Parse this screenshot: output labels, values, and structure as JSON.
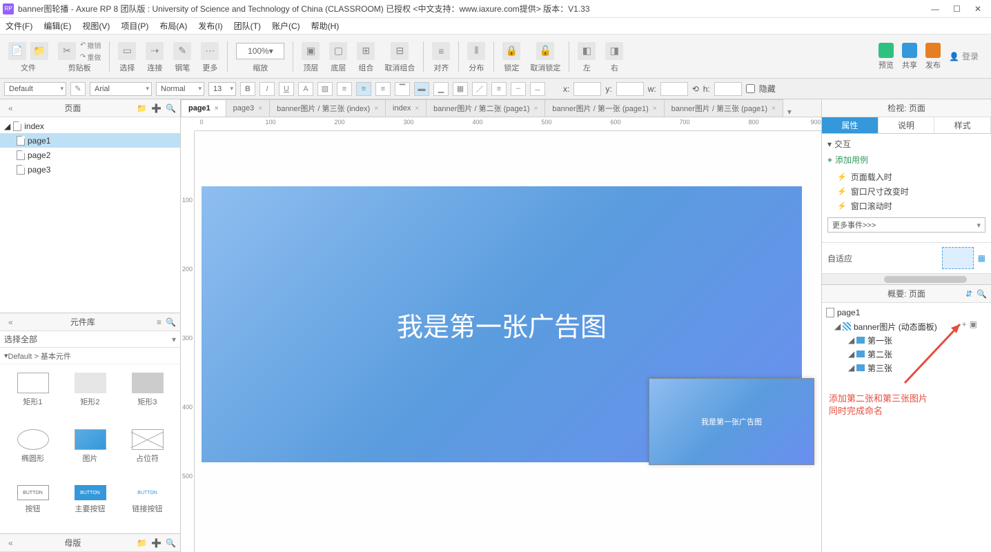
{
  "title": "banner图轮播 - Axure RP 8 团队版 : University of Science and Technology of China (CLASSROOM) 已授权    <中文支持：www.iaxure.com提供> 版本：V1.33",
  "menu": [
    "文件(F)",
    "编辑(E)",
    "视图(V)",
    "项目(P)",
    "布局(A)",
    "发布(I)",
    "团队(T)",
    "账户(C)",
    "帮助(H)"
  ],
  "toolbar": {
    "file": "文件",
    "clipboard": "剪贴板",
    "undo": "撤销",
    "redo": "重做",
    "select": "选择",
    "connect": "连接",
    "pen": "钢笔",
    "more": "更多",
    "zoom": "100%",
    "zoomLabel": "缩放",
    "top": "顶层",
    "bottom": "底层",
    "group": "组合",
    "ungroup": "取消组合",
    "align": "对齐",
    "distribute": "分布",
    "lock": "锁定",
    "unlock": "取消锁定",
    "left": "左",
    "right": "右",
    "preview": "预览",
    "share": "共享",
    "publish": "发布",
    "login": "登录"
  },
  "format": {
    "style": "Default",
    "font": "Arial",
    "weight": "Normal",
    "size": "13",
    "x": "x:",
    "y": "y:",
    "w": "w:",
    "h": "h:",
    "hide": "隐藏"
  },
  "pagesPanel": {
    "title": "页面"
  },
  "pages": {
    "root": "index",
    "children": [
      "page1",
      "page2",
      "page3"
    ],
    "selected": "page1"
  },
  "libPanel": {
    "title": "元件库",
    "select": "选择全部",
    "breadcrumb": "Default > 基本元件"
  },
  "lib": [
    "矩形1",
    "矩形2",
    "矩形3",
    "椭圆形",
    "图片",
    "占位符",
    "按钮",
    "主要按钮",
    "链接按钮"
  ],
  "masters": "母版",
  "tabs": [
    {
      "label": "page1",
      "active": true
    },
    {
      "label": "page3",
      "active": false
    },
    {
      "label": "banner图片 / 第三张 (index)",
      "active": false
    },
    {
      "label": "index",
      "active": false
    },
    {
      "label": "banner图片 / 第二张 (page1)",
      "active": false
    },
    {
      "label": "banner图片 / 第一张 (page1)",
      "active": false
    },
    {
      "label": "banner图片 / 第三张 (page1)",
      "active": false
    }
  ],
  "rulerH": [
    "0",
    "100",
    "200",
    "300",
    "400",
    "500",
    "600",
    "700",
    "800",
    "900"
  ],
  "rulerV": [
    "100",
    "200",
    "300",
    "400",
    "500"
  ],
  "bannerText": "我是第一张广告图",
  "thumbText": "我是第一张广告图",
  "inspect": {
    "header": "检视: 页面",
    "tabs": [
      "属性",
      "说明",
      "样式"
    ],
    "interact": "交互",
    "addCase": "添加用例",
    "events": [
      "页面载入时",
      "窗口尺寸改变时",
      "窗口滚动时"
    ],
    "moreEvents": "更多事件>>>",
    "adapt": "自适应"
  },
  "outline": {
    "header": "概要: 页面",
    "page": "page1",
    "dp": "banner图片 (动态面板)",
    "states": [
      "第一张",
      "第二张",
      "第三张"
    ]
  },
  "annotation": "添加第二张和第三张图片\n同时完成命名"
}
